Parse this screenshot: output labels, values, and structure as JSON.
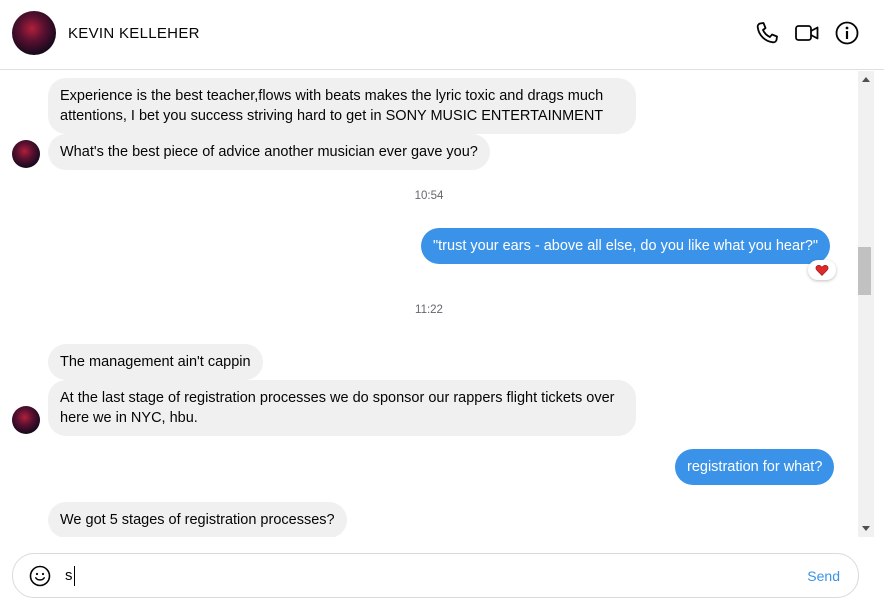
{
  "header": {
    "contact_name": "KEVIN KELLEHER",
    "icons": [
      "phone-icon",
      "video-camera-icon",
      "info-icon"
    ]
  },
  "thread": {
    "messages": [
      {
        "from": "contact",
        "text": "Experience is the best teacher,flows with beats makes the lyric toxic and drags much attentions, I bet you success striving hard to get in SONY MUSIC ENTERTAINMENT"
      },
      {
        "from": "contact",
        "text": "What's the best piece of advice another musician ever gave you?"
      },
      {
        "type": "timestamp",
        "text": "10:54"
      },
      {
        "from": "me",
        "text": "\"trust your ears - above all else, do you like what you hear?\"",
        "reaction": "heart-icon"
      },
      {
        "type": "timestamp",
        "text": "11:22"
      },
      {
        "from": "contact",
        "text": "The management ain't cappin"
      },
      {
        "from": "contact",
        "text": "At the last stage of registration processes we do sponsor our rappers flight tickets over here we in NYC, hbu."
      },
      {
        "from": "me",
        "text": "registration for what?"
      },
      {
        "from": "contact",
        "text": "We got 5 stages of registration processes?"
      }
    ]
  },
  "composer": {
    "value": "s",
    "send_label": "Send",
    "emoji_icon": "smiley-icon"
  },
  "colors": {
    "outgoing_bubble": "#3a93e8",
    "incoming_bubble": "#f0f0f0",
    "reaction_heart": "#e02a2a"
  }
}
